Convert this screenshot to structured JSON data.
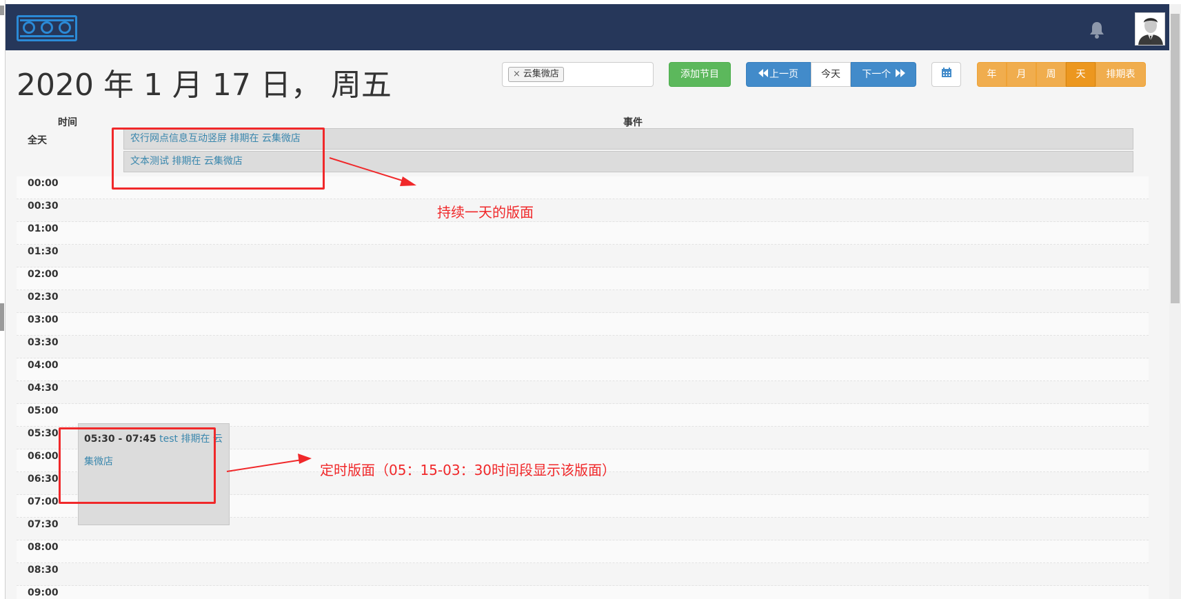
{
  "header": {
    "logo_alt": "adbo",
    "icons": {
      "notifications": "bell-icon",
      "user": "user-avatar-icon"
    }
  },
  "toolbar": {
    "date_title": "2020 年 1 月 17 日， 周五",
    "filter_chip": "云集微店",
    "filter_chip_remove": "×",
    "add_program": "添加节目",
    "prev": "上一页",
    "today": "今天",
    "next": "下一个",
    "calendar_icon": "calendar-icon",
    "views": [
      "年",
      "月",
      "周",
      "天",
      "排期表"
    ],
    "active_view": "天"
  },
  "calendar": {
    "col_time": "时间",
    "col_events": "事件",
    "allday_label": "全天",
    "allday_events": [
      "农行网点信息互动竖屏 排期在 云集微店",
      "文本测试 排期在 云集微店"
    ],
    "slots": [
      "00:00",
      "00:30",
      "01:00",
      "01:30",
      "02:00",
      "02:30",
      "03:00",
      "03:30",
      "04:00",
      "04:30",
      "05:00",
      "05:30",
      "06:00",
      "06:30",
      "07:00",
      "07:30",
      "08:00",
      "08:30",
      "09:00"
    ],
    "timed_event": {
      "time": "05:30 - 07:45",
      "title_line1": "test 排期在 云",
      "title_line2": "集微店"
    }
  },
  "annotations": {
    "allday_note": "持续一天的版面",
    "timed_note": "定时版面（05：15-03：30时间段显示该版面）",
    "color": "#f0282a"
  },
  "colors": {
    "navbar": "#26375a",
    "green": "#5cb85c",
    "blue": "#428bca",
    "orange": "#f0ad4e",
    "event_text": "#3a87ad"
  }
}
